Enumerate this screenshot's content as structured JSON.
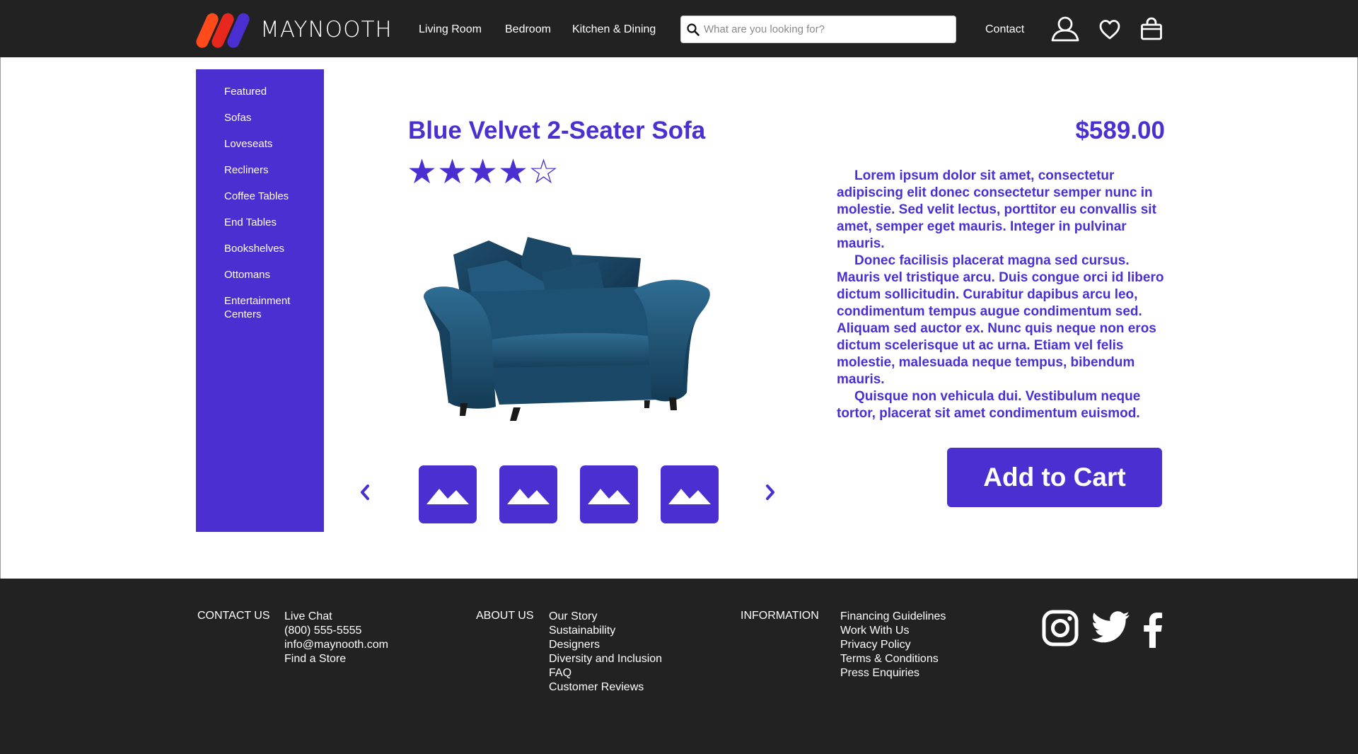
{
  "header": {
    "logo_text": "MAYNOOTH",
    "nav": [
      {
        "label": "Living Room"
      },
      {
        "label": "Bedroom"
      },
      {
        "label": "Kitchen & Dining"
      }
    ],
    "search_placeholder": "What are you looking for?",
    "contact_label": "Contact",
    "icons": [
      "user-icon",
      "heart-icon",
      "shopping-bag-icon"
    ]
  },
  "sidebar": {
    "items": [
      {
        "label": "Featured"
      },
      {
        "label": "Sofas"
      },
      {
        "label": "Loveseats"
      },
      {
        "label": "Recliners"
      },
      {
        "label": "Coffee Tables"
      },
      {
        "label": "End Tables"
      },
      {
        "label": "Bookshelves"
      },
      {
        "label": "Ottomans"
      },
      {
        "label": "Entertainment Centers"
      }
    ]
  },
  "product": {
    "title": "Blue Velvet 2-Seater Sofa",
    "price": "$589.00",
    "rating": 4,
    "rating_max": 5,
    "description": [
      "Lorem ipsum dolor sit amet, consectetur adipiscing elit donec consectetur semper nunc in molestie. Sed velit lectus, porttitor eu convallis sit amet, semper eget mauris. Integer in pulvinar mauris.",
      "Donec facilisis placerat magna sed cursus. Mauris vel tristique arcu. Duis congue orci id libero dictum sollicitudin. Curabitur dapibus arcu leo, condimentum tempus augue condimentum sed. Aliquam sed auctor ex. Nunc quis neque non eros dictum scelerisque ut ac urna. Etiam vel felis molestie, malesuada neque tempus, bibendum mauris.",
      "Quisque non vehicula dui. Vestibulum neque tortor, placerat sit amet condimentum euismod."
    ],
    "add_to_cart_label": "Add to Cart",
    "thumbnail_count": 4
  },
  "footer": {
    "contact": {
      "heading": "CONTACT US",
      "links": [
        "Live Chat",
        "(800) 555-5555",
        "info@maynooth.com",
        "Find a Store"
      ]
    },
    "about": {
      "heading": "ABOUT US",
      "links": [
        "Our Story",
        "Sustainability",
        "Designers",
        "Diversity and Inclusion",
        "FAQ",
        "Customer Reviews"
      ]
    },
    "information": {
      "heading": "INFORMATION",
      "links": [
        "Financing Guidelines",
        "Work With Us",
        "Privacy Policy",
        "Terms & Conditions",
        "Press Enquiries"
      ]
    },
    "social": [
      "instagram-icon",
      "twitter-icon",
      "facebook-icon"
    ]
  },
  "colors": {
    "brand": "#4b2fd1",
    "header_bg": "#222222",
    "logo_orange": "#ff4a1c",
    "logo_purple": "#4b2fd1"
  }
}
